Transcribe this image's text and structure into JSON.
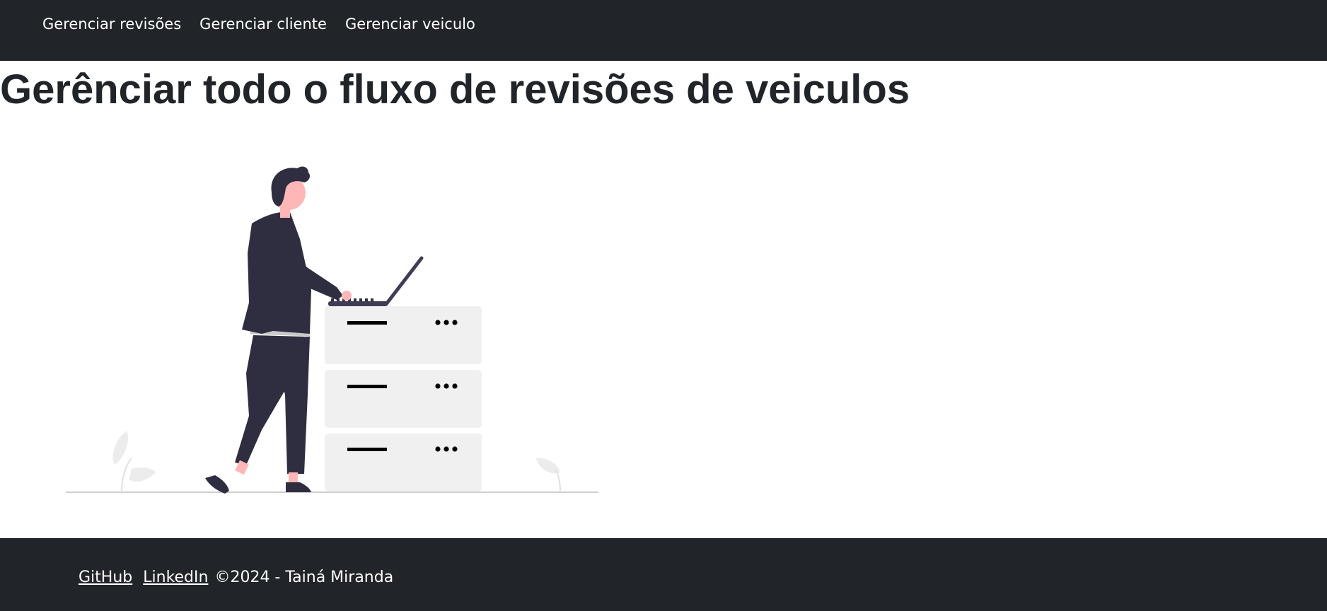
{
  "nav": {
    "items": [
      {
        "label": "Gerenciar revisões"
      },
      {
        "label": "Gerenciar cliente"
      },
      {
        "label": "Gerenciar veiculo"
      }
    ]
  },
  "main": {
    "title": "Gerênciar todo o fluxo de revisões de veiculos",
    "illustration_icon": "person-at-server-with-laptop-illustration"
  },
  "footer": {
    "links": [
      {
        "label": "GitHub"
      },
      {
        "label": "LinkedIn"
      }
    ],
    "copyright": "©2024 - Tainá Miranda"
  },
  "colors": {
    "navbar_bg": "#212529",
    "footer_bg": "#212529",
    "text_dark": "#212529",
    "illustration_dark": "#2f2e41",
    "illustration_light": "#f0f0f0",
    "skin": "#ffb6b6"
  }
}
